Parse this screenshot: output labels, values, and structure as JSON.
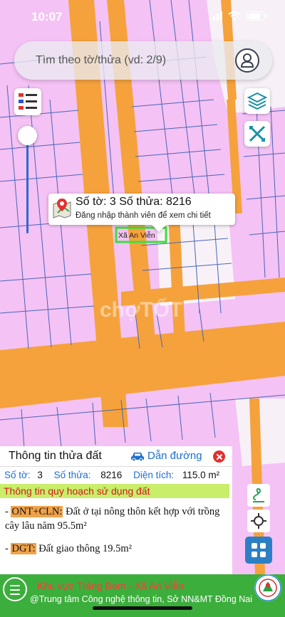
{
  "status_bar": {
    "time": "10:07"
  },
  "search": {
    "placeholder": "Tìm theo tờ/thửa (vd: 2/9)"
  },
  "map": {
    "background_color": "#f4c2f4",
    "road_color": "#f5a23c",
    "boundary_color": "#4a66b8",
    "watermark": "chợTỐT"
  },
  "popup": {
    "title": "Số tờ: 3 Số thửa: 8216",
    "subtitle": "Đăng nhập thành viên để xem chi tiết"
  },
  "map_label": {
    "commune": "Xã An Viễn"
  },
  "info_panel": {
    "title": "Thông tin thửa đất",
    "directions_label": "Dẫn đường",
    "sheet_label": "Số tờ:",
    "sheet_value": "3",
    "parcel_label": "Số thửa:",
    "parcel_value": "8216",
    "area_label": "Diện tích:",
    "area_value": "115.0 m²",
    "planning_header": "Thông tin quy hoạch sử dụng đất",
    "zones": [
      {
        "prefix": "- ",
        "code": "ONT+CLN:",
        "description": " Đất ở tại nông thôn kết hợp với trồng cây lâu năm 95.5m²"
      },
      {
        "prefix": "- ",
        "code": "DGT:",
        "description": " Đất giao thông 19.5m²"
      }
    ]
  },
  "bottom_bar": {
    "area_title": "Khu vực Trảng Bom - Xã An Viễn",
    "credit": "@Trung tâm Công nghệ thông tin, Sở NN&MT Đồng Nai",
    "accent_color": "#3cae3c"
  },
  "icons": {
    "legend": "legend-list-icon",
    "layers": "layers-icon",
    "measure": "measure-tool-icon",
    "user": "user-icon",
    "pin": "map-pin-icon",
    "car": "car-icon",
    "draw": "draw-icon",
    "locate": "locate-crosshair-icon",
    "grid": "grid-menu-icon",
    "menu": "hamburger-icon"
  }
}
